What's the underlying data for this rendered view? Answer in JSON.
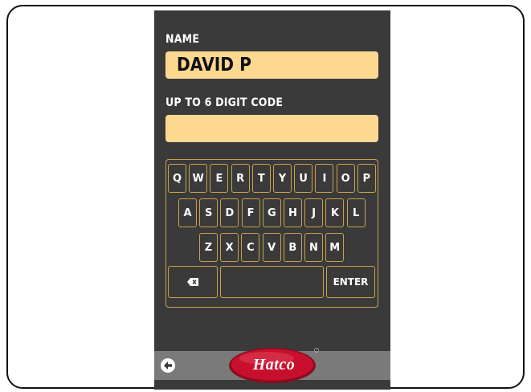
{
  "form": {
    "name_label": "NAME",
    "name_value": "DAVID P",
    "code_label": "UP TO 6 DIGIT CODE",
    "code_value": ""
  },
  "keyboard": {
    "row1": [
      "Q",
      "W",
      "E",
      "R",
      "T",
      "Y",
      "U",
      "I",
      "O",
      "P"
    ],
    "row2": [
      "A",
      "S",
      "D",
      "F",
      "G",
      "H",
      "J",
      "K",
      "L"
    ],
    "row3": [
      "Z",
      "X",
      "C",
      "V",
      "B",
      "N",
      "M"
    ],
    "enter_label": "ENTER",
    "backspace_icon": "backspace-icon",
    "space_label": ""
  },
  "footer": {
    "back_icon": "back-arrow-icon",
    "logo_text": "Hatco"
  },
  "colors": {
    "panel": "#3a3a3a",
    "field": "#fcd891",
    "key_border": "#c8a14a",
    "footer": "#7a7a7a",
    "logo_red": "#c8102e"
  }
}
